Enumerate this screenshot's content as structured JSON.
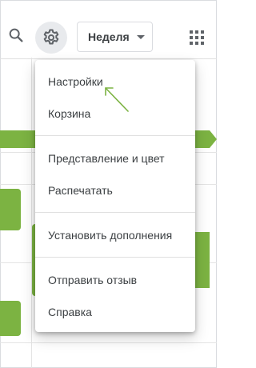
{
  "toolbar": {
    "search_icon": "search-icon",
    "settings_icon": "gear-icon",
    "apps_icon": "apps-grid-icon",
    "view_select": {
      "selected": "Неделя"
    }
  },
  "menu": {
    "items": [
      {
        "label": "Настройки"
      },
      {
        "label": "Корзина"
      },
      {
        "label": "Представление и цвет"
      },
      {
        "label": "Распечатать"
      },
      {
        "label": "Установить дополнения"
      },
      {
        "label": "Отправить отзыв"
      },
      {
        "label": "Справка"
      }
    ]
  },
  "colors": {
    "event": "#7cb342",
    "annotation_arrow": "#7cb342",
    "text": "#3c4043",
    "icon": "#5f6368"
  }
}
